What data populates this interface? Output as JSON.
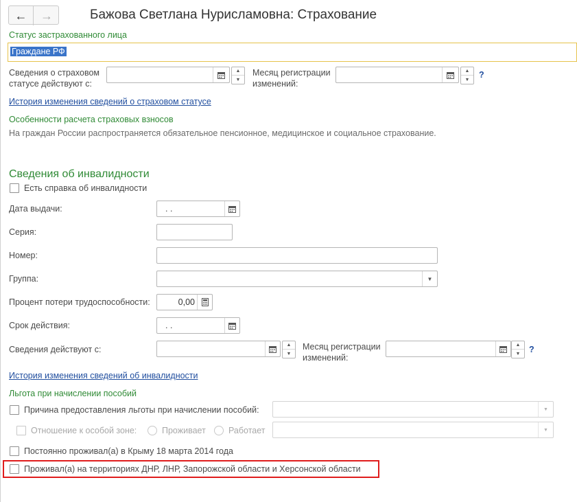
{
  "header": {
    "title": "Бажова Светлана Нурисламовна: Страхование",
    "back_label": "←",
    "forward_label": "→"
  },
  "insurance": {
    "status_label": "Статус застрахованного лица",
    "status_value": "Граждане РФ",
    "status_effective_label_1": "Сведения о страховом",
    "status_effective_label_2": "статусе действуют с:",
    "status_effective_value": "",
    "reg_month_label_1": "Месяц регистрации",
    "reg_month_label_2": "изменений:",
    "reg_month_value": "",
    "help": "?",
    "history_link": "История изменения сведений о страховом статусе",
    "features_label": "Особенности расчета страховых взносов",
    "features_text": "На граждан России распространяется обязательное пенсионное, медицинское и социальное страхование."
  },
  "disability": {
    "section_title": "Сведения об инвалидности",
    "has_certificate_label": "Есть справка об инвалидности",
    "has_certificate": false,
    "issue_date_label": "Дата выдачи:",
    "issue_date_value": ".  .",
    "series_label": "Серия:",
    "series_value": "",
    "number_label": "Номер:",
    "number_value": "",
    "group_label": "Группа:",
    "group_value": "",
    "loss_percent_label": "Процент потери трудоспособности:",
    "loss_percent_value": "0,00",
    "validity_label": "Срок действия:",
    "validity_value": ".  .",
    "effective_from_label": "Сведения действуют с:",
    "effective_from_value": "",
    "reg_month_label_1": "Месяц регистрации",
    "reg_month_label_2": "изменений:",
    "reg_month_value": "",
    "help": "?",
    "history_link": "История изменения сведений об инвалидности"
  },
  "benefits": {
    "section_label": "Льгота при начислении пособий",
    "reason_label": "Причина предоставления льготы при начислении пособий:",
    "reason_value": "",
    "zone_label": "Отношение к особой зоне:",
    "zone_option_1": "Проживает",
    "zone_option_2": "Работает",
    "zone_value": "",
    "crimea_label": "Постоянно проживал(а) в Крыму 18 марта 2014 года",
    "territories_label": "Проживал(а) на территориях ДНР, ЛНР, Запорожской области и Херсонской области"
  },
  "colors": {
    "section_green": "#2f8a35",
    "link_blue": "#1f4d9e",
    "highlight_yellow": "#e6c24a",
    "selection_blue": "#3a74c9",
    "annotation_red": "#e01b1b"
  }
}
